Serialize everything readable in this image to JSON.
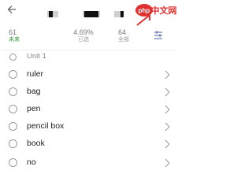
{
  "header": {
    "back_icon": "back-arrow-icon",
    "watermark": "php中文网"
  },
  "stats": [
    {
      "value": "61",
      "label": "未来",
      "label_color": "#3a9a3a"
    },
    {
      "value": "4.69%",
      "label": "已选",
      "label_color": "#9a9a9a"
    },
    {
      "value": "64",
      "label": "全部",
      "label_color": "#9a9a9a"
    }
  ],
  "mode_icon": "list-mode-icon",
  "unit": {
    "title": "Unit 1"
  },
  "words": [
    "ruler",
    "bag",
    "pen",
    "pencil box",
    "book",
    "no"
  ],
  "colors": {
    "accent_red": "#e03030",
    "text": "#222222",
    "muted": "#9a9a9a"
  }
}
